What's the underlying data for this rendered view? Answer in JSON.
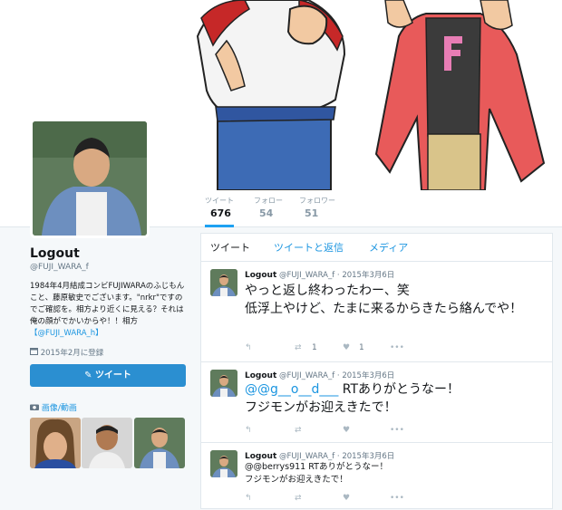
{
  "stats": [
    {
      "label": "ツイート",
      "value": "676"
    },
    {
      "label": "フォロー",
      "value": "54"
    },
    {
      "label": "フォロワー",
      "value": "51"
    }
  ],
  "profile": {
    "name": "Logout",
    "handle": "@FUJI_WARA_f",
    "bio_text": "1984年4月結成コンビFUJIWARAのふじもんこと、藤原敏史でございます。\"nrkr\"ですのでご確認を。相方より近くに見える？それは俺の顔がでかいからや！！相方",
    "bio_link": "【@FUJI_WARA_h】",
    "joined": "2015年2月に登録",
    "tweet_button": "ツイート",
    "media_header": "画像/動画"
  },
  "tabs": [
    "ツイート",
    "ツイートと返信",
    "メディア"
  ],
  "tweets": [
    {
      "name": "Logout",
      "meta": "@FUJI_WARA_f · 2015年3月6日",
      "line1": "やっと返し終わったわー、笑",
      "line2": "低浮上やけど、たまに来るからきたら絡んでや！",
      "retweets": "1",
      "likes": "1"
    },
    {
      "name": "Logout",
      "meta": "@FUJI_WARA_f · 2015年3月6日",
      "mention": "@@g__o__d___",
      "line1": " RTありがとうなー！",
      "line2": "フジモンがお迎えきたで！",
      "retweets": "",
      "likes": ""
    },
    {
      "name": "Logout",
      "meta": "@FUJI_WARA_f · 2015年3月6日",
      "line1": "@@berrys911 RTありがとうなー！",
      "line2": "フジモンがお迎えきたで！",
      "retweets": "",
      "likes": ""
    }
  ],
  "icons": {
    "reply": "reply-icon",
    "retweet": "retweet-icon",
    "like": "heart-icon",
    "more": "more-icon",
    "calendar": "calendar-icon",
    "camera": "camera-icon",
    "quill": "quill-icon"
  },
  "colors": {
    "accent": "#1da1f2",
    "button": "#2b8fd1",
    "link": "#1b95e0"
  }
}
